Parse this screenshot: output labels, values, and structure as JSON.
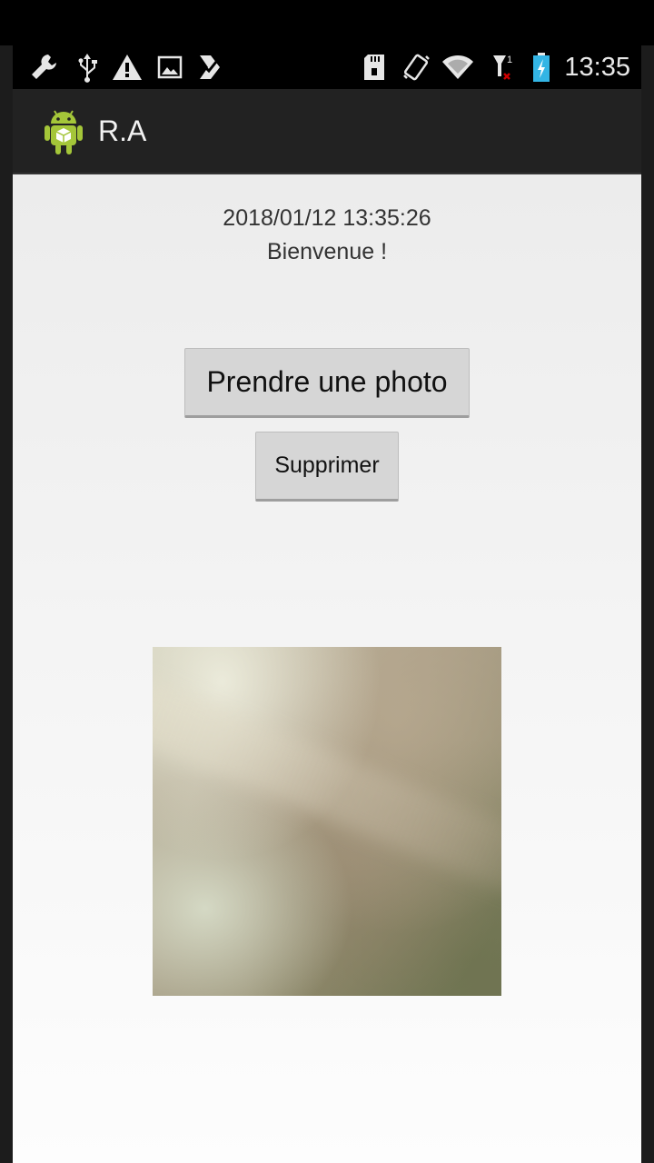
{
  "status_bar": {
    "time": "13:35",
    "left_icons": [
      "wrench-icon",
      "usb-icon",
      "warning-icon",
      "image-icon",
      "checklist-icon"
    ],
    "right_icons": [
      "sd-card-icon",
      "vibrate-icon",
      "wifi-icon",
      "signal-no-sim-icon",
      "battery-charging-icon"
    ]
  },
  "action_bar": {
    "title": "R.A",
    "icon": "android-icon"
  },
  "main": {
    "datetime": "2018/01/12 13:35:26",
    "welcome": "Bienvenue !",
    "take_photo_label": "Prendre une photo",
    "delete_label": "Supprimer"
  },
  "colors": {
    "android_green": "#a4c639",
    "battery_blue": "#33b5e5",
    "signal_red": "#cc0000"
  }
}
